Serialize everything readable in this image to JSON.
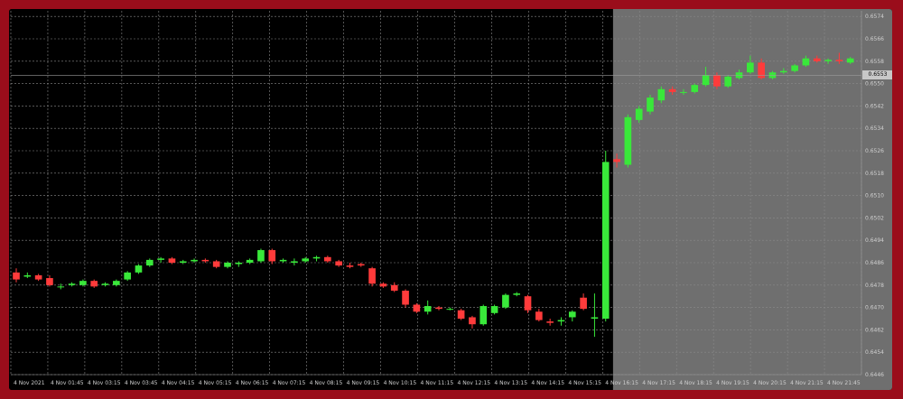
{
  "app": {
    "title": ""
  },
  "colors": {
    "frame": "#9a0d1b",
    "background": "#000000",
    "shaded_region": "#6f6f6f",
    "grid": "#8a8a8a",
    "bull": "#39e83a",
    "bear": "#ff3b3b",
    "axis_text": "#cfcfcf",
    "badge": "#c8c8c8"
  },
  "icons": [
    "none"
  ],
  "chart_data": {
    "type": "candlestick",
    "title": "",
    "xlabel": "",
    "ylabel": "",
    "grid": true,
    "shaded_from_index": 47,
    "ylim": [
      0.6446,
      0.6576
    ],
    "y_ticks": [
      "0.6446",
      "0.6454",
      "0.6462",
      "0.6470",
      "0.6478",
      "0.6486",
      "0.6494",
      "0.6502",
      "0.6510",
      "0.6518",
      "0.6526",
      "0.6534",
      "0.6542",
      "0.6550",
      "0.6558",
      "0.6566",
      "0.6574"
    ],
    "current_price_label": "0.6553",
    "x_tick_labels": [
      "4 Nov 2021",
      "4 Nov 01:45",
      "4 Nov 03:15",
      "4 Nov 03:45",
      "4 Nov 04:15",
      "4 Nov 05:15",
      "4 Nov 06:15",
      "4 Nov 07:15",
      "4 Nov 08:15",
      "4 Nov 09:15",
      "4 Nov 10:15",
      "4 Nov 11:15",
      "4 Nov 12:15",
      "4 Nov 13:15",
      "4 Nov 14:15",
      "4 Nov 15:15",
      "4 Nov 16:15",
      "4 Nov 17:15",
      "4 Nov 18:15",
      "4 Nov 19:15",
      "4 Nov 20:15",
      "4 Nov 21:15",
      "4 Nov 21:45"
    ],
    "candles": [
      {
        "o": 0.64825,
        "h": 0.6484,
        "l": 0.6479,
        "c": 0.648
      },
      {
        "o": 0.6481,
        "h": 0.64825,
        "l": 0.64805,
        "c": 0.64815
      },
      {
        "o": 0.64815,
        "h": 0.6482,
        "l": 0.64795,
        "c": 0.648
      },
      {
        "o": 0.64805,
        "h": 0.64815,
        "l": 0.64775,
        "c": 0.6478
      },
      {
        "o": 0.64775,
        "h": 0.64785,
        "l": 0.64765,
        "c": 0.64775
      },
      {
        "o": 0.6478,
        "h": 0.6479,
        "l": 0.64775,
        "c": 0.64785
      },
      {
        "o": 0.6478,
        "h": 0.648,
        "l": 0.64775,
        "c": 0.64795
      },
      {
        "o": 0.64795,
        "h": 0.648,
        "l": 0.6477,
        "c": 0.64775
      },
      {
        "o": 0.6478,
        "h": 0.6479,
        "l": 0.64775,
        "c": 0.64785
      },
      {
        "o": 0.6478,
        "h": 0.648,
        "l": 0.64775,
        "c": 0.64795
      },
      {
        "o": 0.648,
        "h": 0.6483,
        "l": 0.64795,
        "c": 0.64825
      },
      {
        "o": 0.64825,
        "h": 0.64855,
        "l": 0.6482,
        "c": 0.6485
      },
      {
        "o": 0.6485,
        "h": 0.64875,
        "l": 0.64845,
        "c": 0.6487
      },
      {
        "o": 0.6487,
        "h": 0.6488,
        "l": 0.6486,
        "c": 0.64875
      },
      {
        "o": 0.64875,
        "h": 0.6488,
        "l": 0.64855,
        "c": 0.6486
      },
      {
        "o": 0.6486,
        "h": 0.6487,
        "l": 0.64855,
        "c": 0.64865
      },
      {
        "o": 0.64865,
        "h": 0.64875,
        "l": 0.6486,
        "c": 0.6487
      },
      {
        "o": 0.6487,
        "h": 0.64875,
        "l": 0.6486,
        "c": 0.64865
      },
      {
        "o": 0.64865,
        "h": 0.6487,
        "l": 0.6484,
        "c": 0.64845
      },
      {
        "o": 0.64845,
        "h": 0.64865,
        "l": 0.6484,
        "c": 0.6486
      },
      {
        "o": 0.64855,
        "h": 0.64865,
        "l": 0.64845,
        "c": 0.6486
      },
      {
        "o": 0.6486,
        "h": 0.64875,
        "l": 0.64855,
        "c": 0.6487
      },
      {
        "o": 0.64865,
        "h": 0.6491,
        "l": 0.6486,
        "c": 0.64905
      },
      {
        "o": 0.64905,
        "h": 0.6491,
        "l": 0.64855,
        "c": 0.64865
      },
      {
        "o": 0.64865,
        "h": 0.64875,
        "l": 0.6486,
        "c": 0.6487
      },
      {
        "o": 0.6486,
        "h": 0.64875,
        "l": 0.6485,
        "c": 0.64865
      },
      {
        "o": 0.64865,
        "h": 0.6488,
        "l": 0.6486,
        "c": 0.64875
      },
      {
        "o": 0.64875,
        "h": 0.64885,
        "l": 0.64865,
        "c": 0.6488
      },
      {
        "o": 0.6488,
        "h": 0.64885,
        "l": 0.6486,
        "c": 0.64865
      },
      {
        "o": 0.64865,
        "h": 0.6487,
        "l": 0.64845,
        "c": 0.6485
      },
      {
        "o": 0.6485,
        "h": 0.6486,
        "l": 0.6484,
        "c": 0.64845
      },
      {
        "o": 0.64855,
        "h": 0.6486,
        "l": 0.64845,
        "c": 0.6485
      },
      {
        "o": 0.6484,
        "h": 0.64845,
        "l": 0.64775,
        "c": 0.64785
      },
      {
        "o": 0.64785,
        "h": 0.6479,
        "l": 0.6477,
        "c": 0.64775
      },
      {
        "o": 0.6478,
        "h": 0.6479,
        "l": 0.64755,
        "c": 0.6476
      },
      {
        "o": 0.6476,
        "h": 0.64765,
        "l": 0.647,
        "c": 0.6471
      },
      {
        "o": 0.6471,
        "h": 0.64715,
        "l": 0.6468,
        "c": 0.64685
      },
      {
        "o": 0.64685,
        "h": 0.64725,
        "l": 0.64675,
        "c": 0.64705
      },
      {
        "o": 0.647,
        "h": 0.64705,
        "l": 0.6469,
        "c": 0.64695
      },
      {
        "o": 0.64695,
        "h": 0.647,
        "l": 0.6469,
        "c": 0.64695
      },
      {
        "o": 0.6469,
        "h": 0.64695,
        "l": 0.64655,
        "c": 0.6466
      },
      {
        "o": 0.64665,
        "h": 0.6467,
        "l": 0.64625,
        "c": 0.6464
      },
      {
        "o": 0.6464,
        "h": 0.6471,
        "l": 0.64635,
        "c": 0.64705
      },
      {
        "o": 0.6468,
        "h": 0.6471,
        "l": 0.64675,
        "c": 0.64705
      },
      {
        "o": 0.647,
        "h": 0.6475,
        "l": 0.64695,
        "c": 0.64745
      },
      {
        "o": 0.64745,
        "h": 0.64755,
        "l": 0.6474,
        "c": 0.6475
      },
      {
        "o": 0.6474,
        "h": 0.64745,
        "l": 0.6468,
        "c": 0.6469
      },
      {
        "o": 0.64685,
        "h": 0.64695,
        "l": 0.6465,
        "c": 0.64655
      },
      {
        "o": 0.6465,
        "h": 0.6466,
        "l": 0.64635,
        "c": 0.64645
      },
      {
        "o": 0.6465,
        "h": 0.64665,
        "l": 0.64635,
        "c": 0.64655
      },
      {
        "o": 0.64665,
        "h": 0.6469,
        "l": 0.6465,
        "c": 0.64685
      },
      {
        "o": 0.64735,
        "h": 0.6475,
        "l": 0.6469,
        "c": 0.64695
      },
      {
        "o": 0.6466,
        "h": 0.6475,
        "l": 0.64595,
        "c": 0.64665
      },
      {
        "o": 0.6466,
        "h": 0.6526,
        "l": 0.6465,
        "c": 0.6522
      }
    ],
    "candles_shaded": [
      {
        "o": 0.6523,
        "h": 0.6525,
        "l": 0.652,
        "c": 0.6522
      },
      {
        "o": 0.6521,
        "h": 0.6539,
        "l": 0.652,
        "c": 0.6538
      },
      {
        "o": 0.6537,
        "h": 0.6542,
        "l": 0.6536,
        "c": 0.6541
      },
      {
        "o": 0.654,
        "h": 0.6546,
        "l": 0.6539,
        "c": 0.6545
      },
      {
        "o": 0.6544,
        "h": 0.6549,
        "l": 0.6543,
        "c": 0.6548
      },
      {
        "o": 0.6548,
        "h": 0.6549,
        "l": 0.6546,
        "c": 0.6547
      },
      {
        "o": 0.6547,
        "h": 0.6548,
        "l": 0.6546,
        "c": 0.6547
      },
      {
        "o": 0.6547,
        "h": 0.655,
        "l": 0.65465,
        "c": 0.65495
      },
      {
        "o": 0.65495,
        "h": 0.6556,
        "l": 0.6549,
        "c": 0.6553
      },
      {
        "o": 0.6553,
        "h": 0.6554,
        "l": 0.6548,
        "c": 0.6549
      },
      {
        "o": 0.6549,
        "h": 0.6553,
        "l": 0.65485,
        "c": 0.65525
      },
      {
        "o": 0.6552,
        "h": 0.6555,
        "l": 0.65515,
        "c": 0.6554
      },
      {
        "o": 0.6554,
        "h": 0.656,
        "l": 0.65535,
        "c": 0.65575
      },
      {
        "o": 0.65575,
        "h": 0.6559,
        "l": 0.65515,
        "c": 0.6552
      },
      {
        "o": 0.6552,
        "h": 0.65545,
        "l": 0.65515,
        "c": 0.6554
      },
      {
        "o": 0.6554,
        "h": 0.65555,
        "l": 0.65535,
        "c": 0.65545
      },
      {
        "o": 0.65545,
        "h": 0.6557,
        "l": 0.6554,
        "c": 0.65565
      },
      {
        "o": 0.65565,
        "h": 0.656,
        "l": 0.6556,
        "c": 0.6559
      },
      {
        "o": 0.6559,
        "h": 0.656,
        "l": 0.65575,
        "c": 0.6558
      },
      {
        "o": 0.6558,
        "h": 0.6559,
        "l": 0.6557,
        "c": 0.65585
      },
      {
        "o": 0.65585,
        "h": 0.6561,
        "l": 0.6557,
        "c": 0.6558
      },
      {
        "o": 0.65575,
        "h": 0.65595,
        "l": 0.6557,
        "c": 0.6559
      }
    ]
  }
}
